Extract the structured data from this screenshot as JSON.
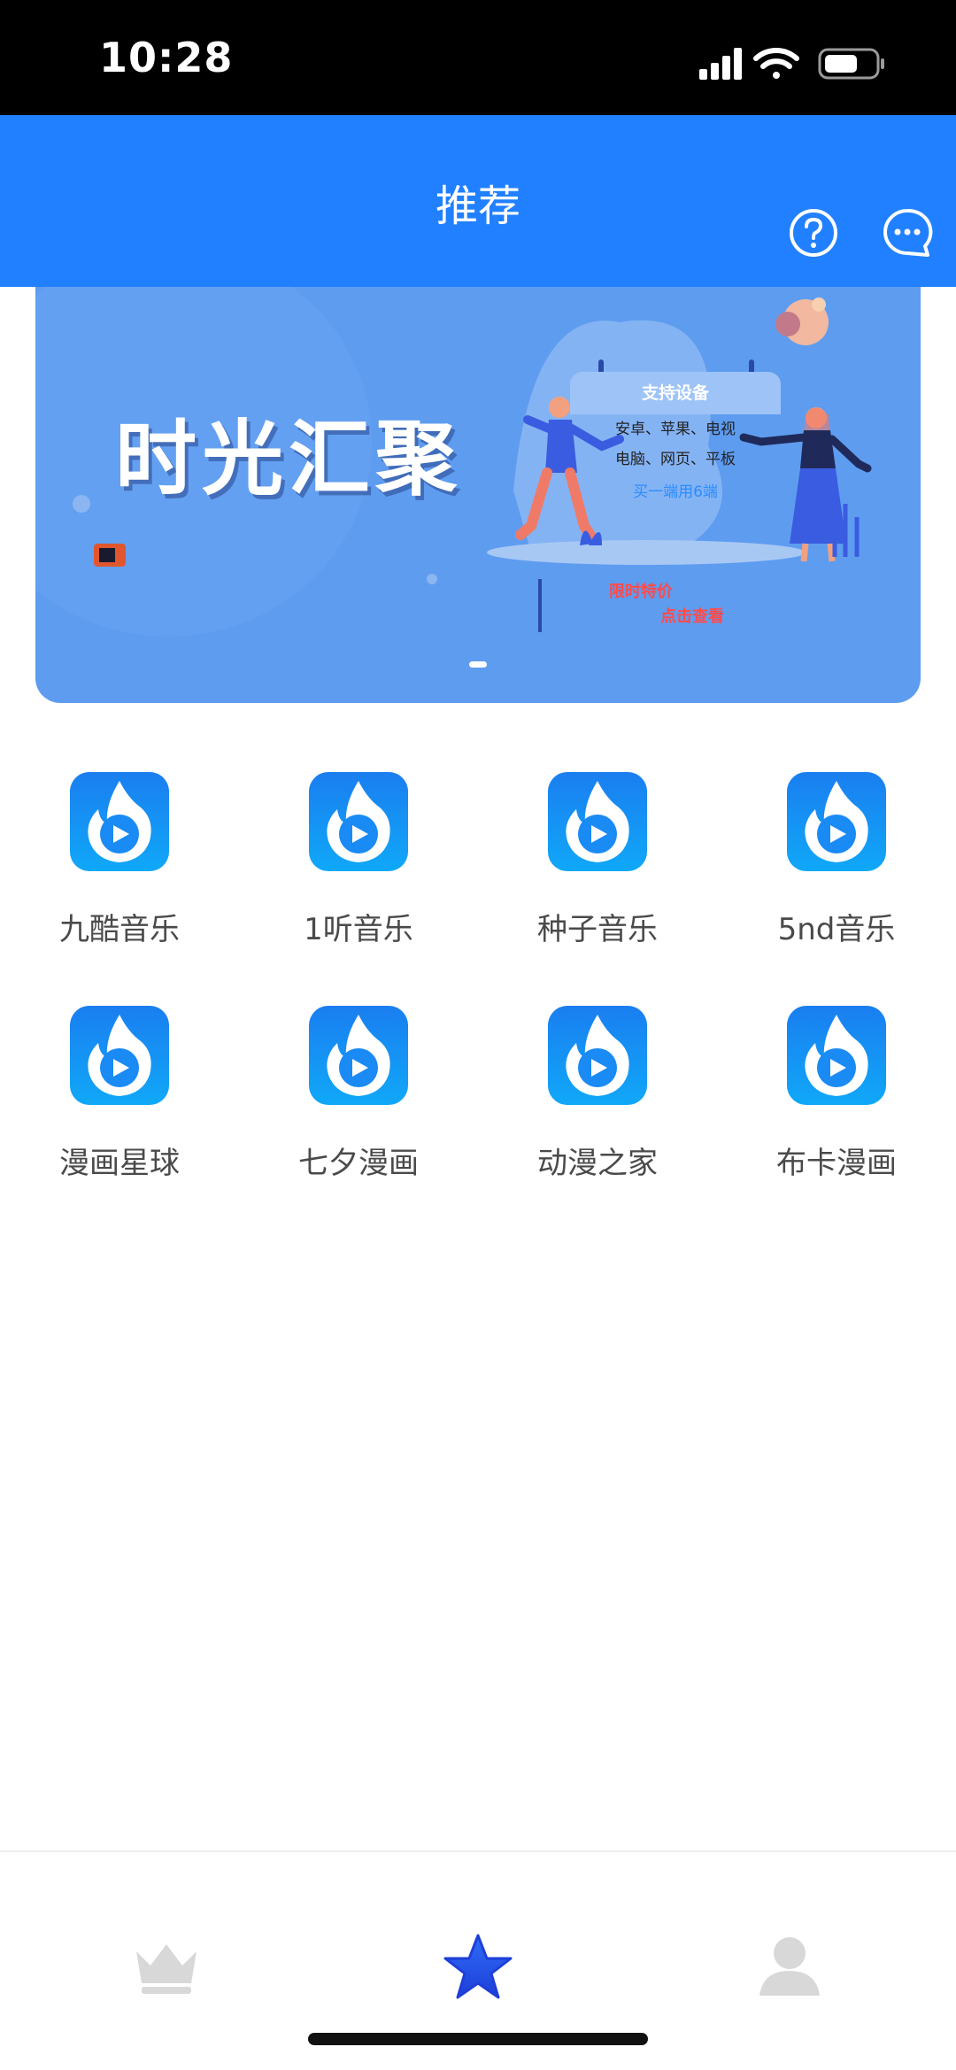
{
  "status_bar": {
    "time": "10:28"
  },
  "header": {
    "title": "推荐"
  },
  "banner": {
    "title": "时光汇聚",
    "card_title": "支持设备",
    "card_line1": "安卓、苹果、电视",
    "card_line2": "电脑、网页、平板",
    "card_cta": "买一端用6端",
    "promo_line1": "限时特价",
    "promo_line2": "点击查看"
  },
  "apps": [
    {
      "label": "九酷音乐"
    },
    {
      "label": "1听音乐"
    },
    {
      "label": "种子音乐"
    },
    {
      "label": "5nd音乐"
    },
    {
      "label": "漫画星球"
    },
    {
      "label": "七夕漫画"
    },
    {
      "label": "动漫之家"
    },
    {
      "label": "布卡漫画"
    }
  ],
  "tab_bar": {
    "tabs": [
      {
        "icon": "crown-icon",
        "active": false
      },
      {
        "icon": "star-icon",
        "active": true
      },
      {
        "icon": "person-icon",
        "active": false
      }
    ],
    "active_color": "#2a5cf0",
    "inactive_color": "#d8d8d8"
  },
  "colors": {
    "nav": "#2080ff",
    "banner": "#5e9cf0"
  }
}
